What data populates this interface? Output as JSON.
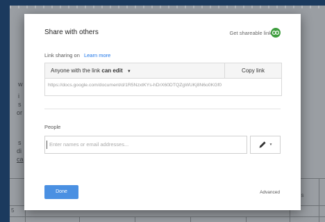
{
  "background_doc": {
    "left_fragments": [
      "w",
      "i",
      "s",
      "or",
      "s",
      "di",
      "ca"
    ],
    "table_fragments": [
      "ns",
      "5"
    ]
  },
  "dialog": {
    "title": "Share with others",
    "shareable_link": "Get shareable link",
    "link_icon": "link-icon",
    "link_sharing_label": "Link sharing on",
    "learn_more": "Learn more",
    "access_prefix": "Anyone with the link",
    "access_level": "can edit",
    "copy_link": "Copy link",
    "url": "https://docs.google.com/document/d/1R5NzxtKYs-hDrX60DTQZgWUKj8N6o0KGf0",
    "people_label": "People",
    "people_placeholder": "Enter names or email addresses...",
    "edit_icon": "pencil-icon",
    "done": "Done",
    "advanced": "Advanced"
  },
  "colors": {
    "accent": "#4a90e2",
    "link_badge": "#3f9e3f",
    "link_text": "#1a73e8",
    "desktop_bg": "#1b3a5e"
  }
}
